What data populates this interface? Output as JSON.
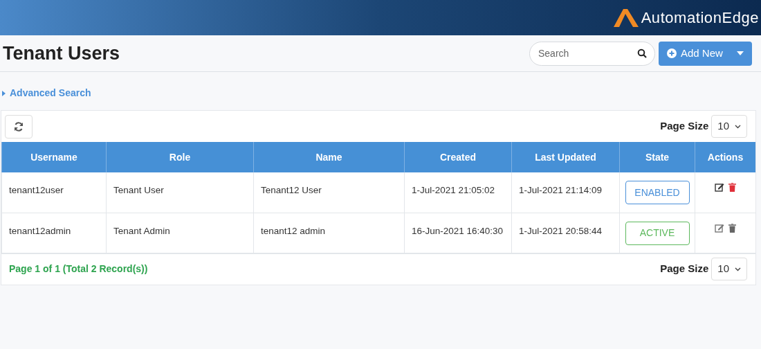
{
  "brand": {
    "name": "AutomationEdge"
  },
  "page": {
    "title": "Tenant Users"
  },
  "search": {
    "placeholder": "Search"
  },
  "add_button": {
    "label": "Add New"
  },
  "advanced_search": {
    "label": "Advanced Search",
    "expanded": false
  },
  "page_size_top": {
    "label": "Page Size",
    "value": "10"
  },
  "table": {
    "columns": [
      "Username",
      "Role",
      "Name",
      "Created",
      "Last Updated",
      "State",
      "Actions"
    ],
    "rows": [
      {
        "cells": [
          "tenant12user",
          "Tenant User",
          "Tenant12 User",
          "1-Jul-2021 21:05:02",
          "1-Jul-2021 21:14:09"
        ],
        "state": {
          "label": "ENABLED",
          "kind": "enabled"
        },
        "delete_disabled": false
      },
      {
        "cells": [
          "tenant12admin",
          "Tenant Admin",
          "tenant12 admin",
          "16-Jun-2021 16:40:30",
          "1-Jul-2021 20:58:44"
        ],
        "state": {
          "label": "ACTIVE",
          "kind": "active"
        },
        "delete_disabled": true
      }
    ]
  },
  "footer": {
    "summary": "Page 1 of 1 (Total 2 Record(s))"
  },
  "page_size_bottom": {
    "label": "Page Size",
    "value": "10"
  }
}
